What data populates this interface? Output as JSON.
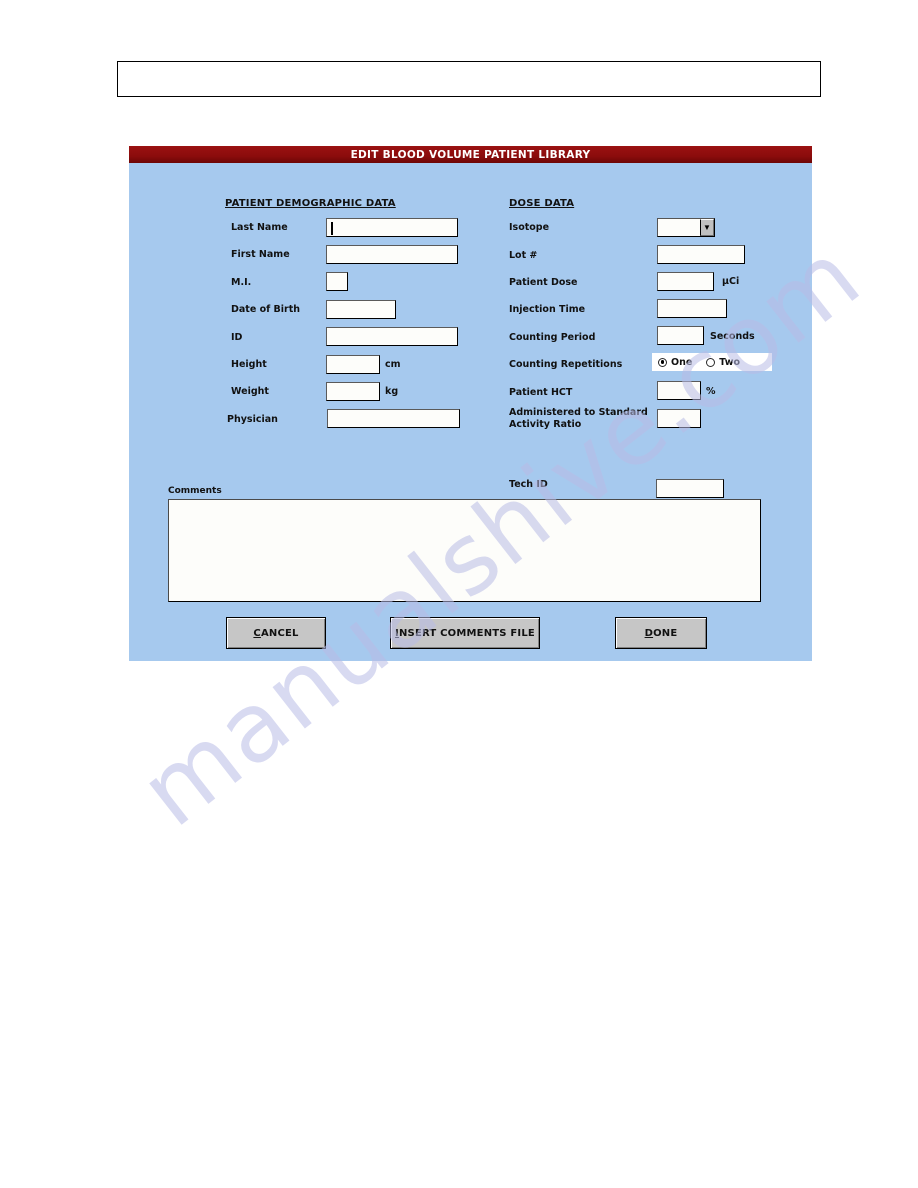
{
  "page": {
    "background_color": "#ffffff",
    "watermark_text": "manualshive.com"
  },
  "header_box": {
    "content": ""
  },
  "dialog": {
    "title": "EDIT BLOOD VOLUME PATIENT LIBRARY",
    "title_bar_color": "#8c0f0f",
    "body_color": "#a6c9ee",
    "sections": {
      "demographic": {
        "heading": "PATIENT DEMOGRAPHIC DATA",
        "fields": [
          {
            "label": "Last Name",
            "value": "",
            "unit": "",
            "focused": true
          },
          {
            "label": "First Name",
            "value": "",
            "unit": "",
            "focused": false
          },
          {
            "label": "M.I.",
            "value": "",
            "unit": "",
            "focused": false
          },
          {
            "label": "Date of Birth",
            "value": "",
            "unit": "",
            "focused": false
          },
          {
            "label": "ID",
            "value": "",
            "unit": "",
            "focused": false
          },
          {
            "label": "Height",
            "value": "",
            "unit": "cm",
            "focused": false
          },
          {
            "label": "Weight",
            "value": "",
            "unit": "kg",
            "focused": false
          },
          {
            "label": "Physician",
            "value": "",
            "unit": "",
            "focused": false
          }
        ]
      },
      "dose": {
        "heading": "DOSE DATA",
        "fields": [
          {
            "label": "Isotope",
            "value": "",
            "unit": "",
            "type": "combo"
          },
          {
            "label": "Lot #",
            "value": "",
            "unit": "",
            "type": "text"
          },
          {
            "label": "Patient Dose",
            "value": "",
            "unit": "µCi",
            "type": "text"
          },
          {
            "label": "Injection Time",
            "value": "",
            "unit": "",
            "type": "text"
          },
          {
            "label": "Counting Period",
            "value": "",
            "unit": "Seconds",
            "type": "text"
          },
          {
            "label": "Counting Repetitions",
            "value": "",
            "unit": "",
            "type": "radio"
          },
          {
            "label": "Patient HCT",
            "value": "",
            "unit": "%",
            "type": "text"
          },
          {
            "label": "Administered to Standard Activity Ratio",
            "label_line1": "Administered to Standard",
            "label_line2": "Activity Ratio",
            "value": "",
            "unit": "",
            "type": "text"
          }
        ],
        "counting_repetitions": {
          "options": [
            "One",
            "Two"
          ],
          "selected": "One"
        }
      },
      "tech": {
        "label": "Tech ID",
        "value": ""
      },
      "comments": {
        "label": "Comments",
        "value": ""
      }
    },
    "buttons": [
      {
        "label": "CANCEL",
        "accel": "C",
        "rest": "ANCEL"
      },
      {
        "label": "INSERT COMMENTS FILE",
        "accel": "I",
        "rest": "NSERT COMMENTS FILE"
      },
      {
        "label": "DONE",
        "accel": "D",
        "rest": "ONE"
      }
    ]
  }
}
